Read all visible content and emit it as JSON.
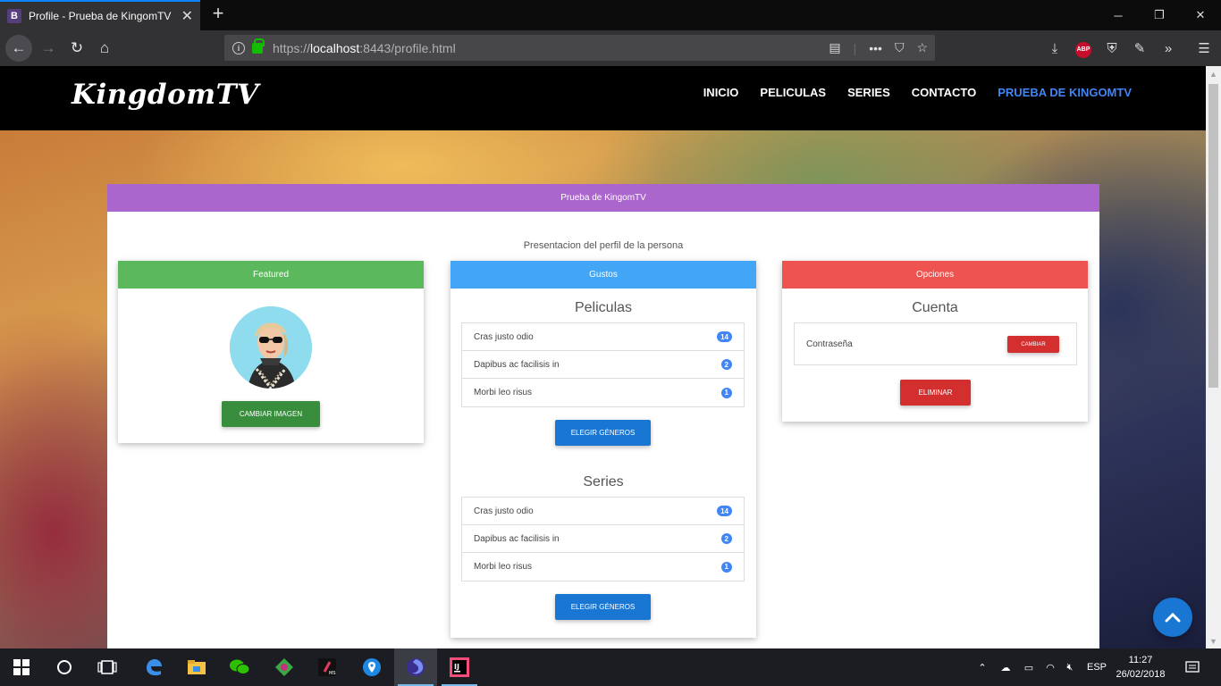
{
  "browser": {
    "tab_title": "Profile - Prueba de KingomTV",
    "tab_favicon": "B",
    "url_scheme": "https://",
    "url_host": "localhost",
    "url_rest": ":8443/profile.html"
  },
  "site": {
    "brand": "KingdomTV",
    "menu": [
      "INICIO",
      "PELICULAS",
      "SERIES",
      "CONTACTO",
      "PRUEBA DE KINGOMTV"
    ]
  },
  "profile": {
    "header": "Prueba de KingomTV",
    "subtitle": "Presentacion del perfil de la persona"
  },
  "featured": {
    "header": "Featured",
    "button": "CAMBIAR IMAGEN"
  },
  "gustos": {
    "header": "Gustos",
    "sections": [
      {
        "title": "Peliculas",
        "items": [
          {
            "label": "Cras justo odio",
            "count": "14"
          },
          {
            "label": "Dapibus ac facilisis in",
            "count": "2"
          },
          {
            "label": "Morbi leo risus",
            "count": "1"
          }
        ],
        "button": "ELEGIR GÉNEROS"
      },
      {
        "title": "Series",
        "items": [
          {
            "label": "Cras justo odio",
            "count": "14"
          },
          {
            "label": "Dapibus ac facilisis in",
            "count": "2"
          },
          {
            "label": "Morbi leo risus",
            "count": "1"
          }
        ],
        "button": "ELEGIR GÉNEROS"
      }
    ]
  },
  "opciones": {
    "header": "Opciones",
    "section_title": "Cuenta",
    "password_label": "Contraseña",
    "change_button": "CAMBIAR",
    "delete_button": "ELIMINAR"
  },
  "taskbar": {
    "language": "ESP",
    "time": "11:27",
    "date": "26/02/2018"
  },
  "colors": {
    "brand_purple": "#aa66cc",
    "featured_green": "#5cb85c",
    "gustos_blue": "#42a5f5",
    "opciones_red": "#ef5350",
    "active_link": "#4285f4"
  }
}
